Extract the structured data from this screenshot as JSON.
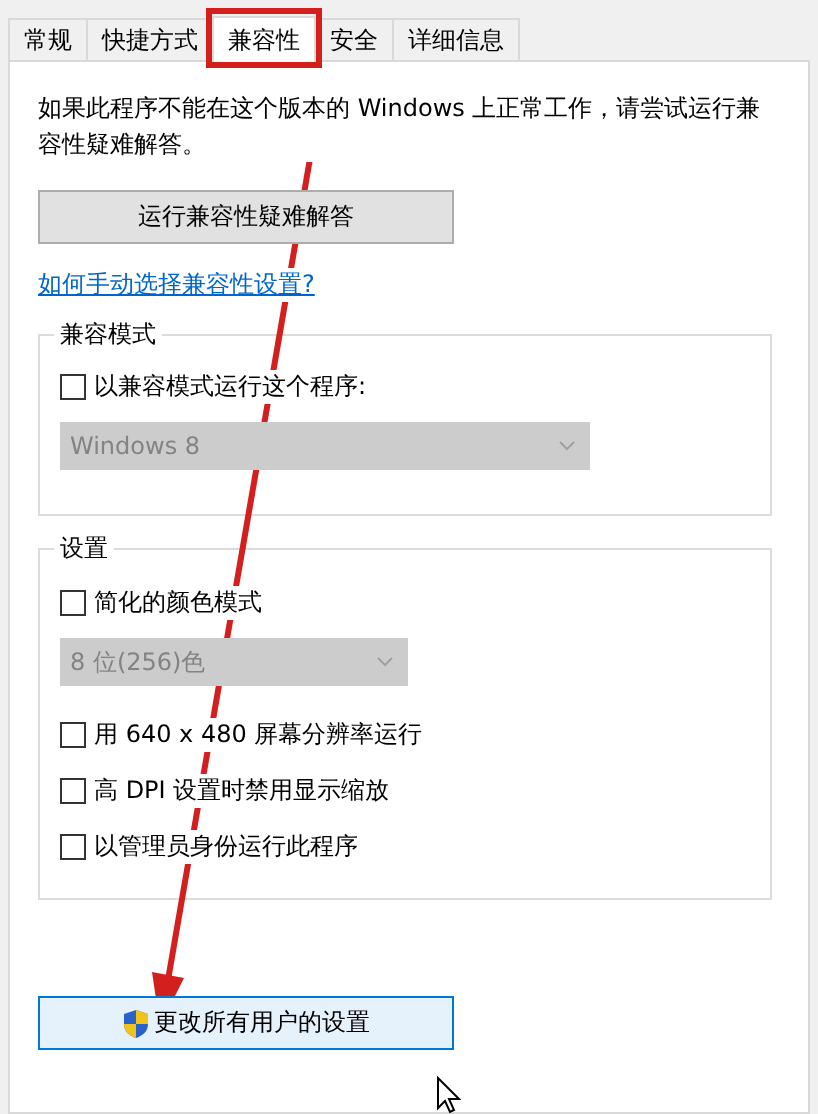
{
  "tabs": [
    {
      "label": "常规",
      "selected": false
    },
    {
      "label": "快捷方式",
      "selected": false
    },
    {
      "label": "兼容性",
      "selected": true
    },
    {
      "label": "安全",
      "selected": false
    },
    {
      "label": "详细信息",
      "selected": false
    }
  ],
  "intro": "如果此程序不能在这个版本的 Windows 上正常工作，请尝试运行兼容性疑难解答。",
  "troubleshoot_button": "运行兼容性疑难解答",
  "help_link": "如何手动选择兼容性设置?",
  "groups": [
    {
      "title": "兼容模式",
      "items": [
        {
          "kind": "checkbox",
          "label": "以兼容模式运行这个程序:",
          "checked": false
        },
        {
          "kind": "dropdown",
          "value": "Windows 8",
          "disabled": true
        }
      ]
    },
    {
      "title": "设置",
      "items": [
        {
          "kind": "checkbox",
          "label": "简化的颜色模式",
          "checked": false
        },
        {
          "kind": "dropdown",
          "value": "8 位(256)色",
          "disabled": true
        },
        {
          "kind": "checkbox",
          "label": "用 640 x 480 屏幕分辨率运行",
          "checked": false
        },
        {
          "kind": "checkbox",
          "label": "高 DPI 设置时禁用显示缩放",
          "checked": false
        },
        {
          "kind": "checkbox",
          "label": "以管理员身份运行此程序",
          "checked": false
        }
      ]
    }
  ],
  "all_users_button": "更改所有用户的设置"
}
